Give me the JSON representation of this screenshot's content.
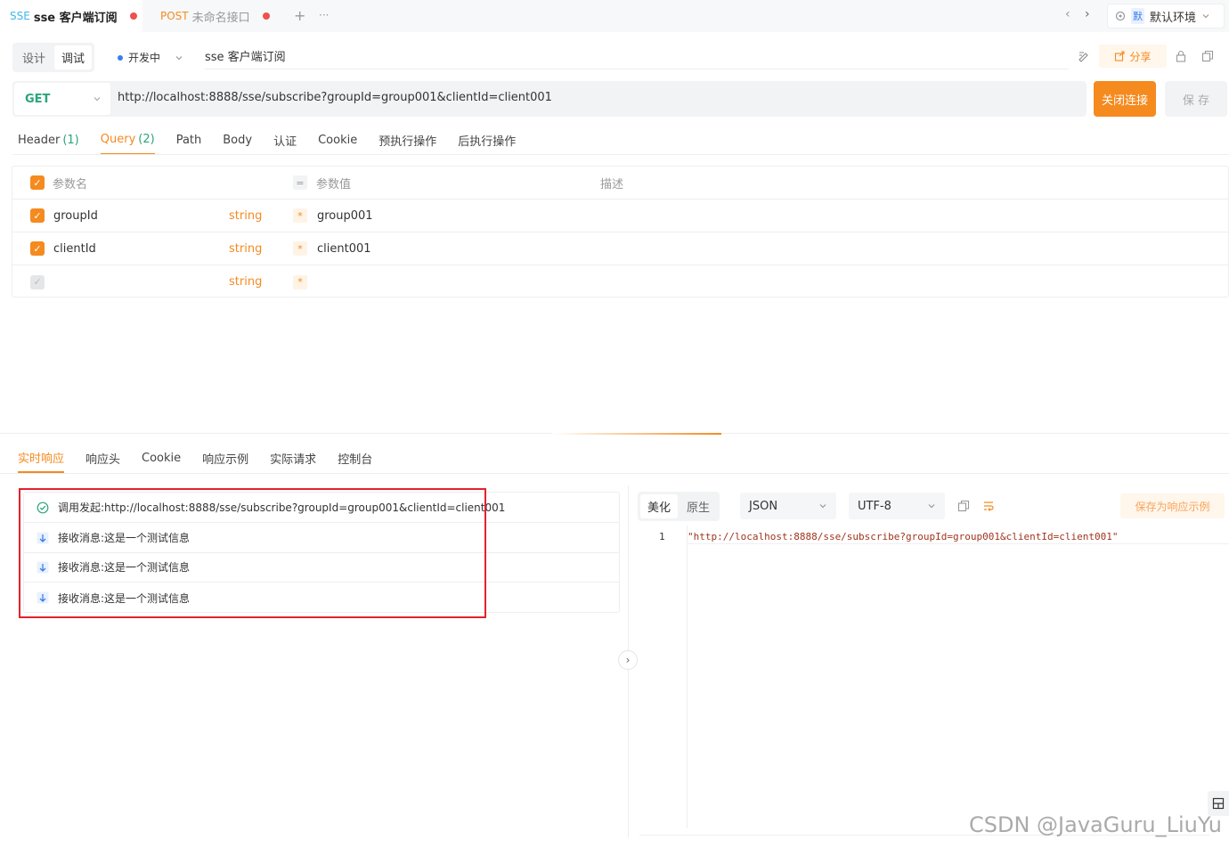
{
  "tabs": [
    {
      "prefix": "SSE",
      "label": "sse 客户端订阅",
      "active": true
    },
    {
      "prefix": "POST",
      "label": "未命名接口",
      "active": false
    }
  ],
  "tabbar": {
    "add": "+",
    "more": "···",
    "nav_left": "‹",
    "nav_right": "›"
  },
  "env": {
    "badge": "默",
    "label": "默认环境"
  },
  "toolbar": {
    "mode_design": "设计",
    "mode_debug": "调试",
    "status": "开发中",
    "api_name": "sse 客户端订阅",
    "share": "分享"
  },
  "request": {
    "method": "GET",
    "url": "http://localhost:8888/sse/subscribe?groupId=group001&clientId=client001",
    "close_button": "关闭连接",
    "save_button": "保 存"
  },
  "request_tabs": [
    {
      "label": "Header",
      "count": "(1)"
    },
    {
      "label": "Query",
      "count": "(2)"
    },
    {
      "label": "Path",
      "count": ""
    },
    {
      "label": "Body",
      "count": ""
    },
    {
      "label": "认证",
      "count": ""
    },
    {
      "label": "Cookie",
      "count": ""
    },
    {
      "label": "预执行操作",
      "count": ""
    },
    {
      "label": "后执行操作",
      "count": ""
    }
  ],
  "params": {
    "headers": {
      "name": "参数名",
      "eq": "=",
      "value": "参数值",
      "desc": "描述"
    },
    "rows": [
      {
        "name": "groupId",
        "type": "string",
        "value": "group001",
        "checked": true
      },
      {
        "name": "clientId",
        "type": "string",
        "value": "client001",
        "checked": true
      },
      {
        "name": "",
        "type": "string",
        "value": "",
        "checked": false
      }
    ]
  },
  "response_tabs": [
    "实时响应",
    "响应头",
    "Cookie",
    "响应示例",
    "实际请求",
    "控制台"
  ],
  "events": [
    {
      "text": "调用发起:http://localhost:8888/sse/subscribe?groupId=group001&clientId=client001",
      "kind": "ok"
    },
    {
      "text": "接收消息:这是一个测试信息",
      "kind": "recv"
    },
    {
      "text": "接收消息:这是一个测试信息",
      "kind": "recv"
    },
    {
      "text": "接收消息:这是一个测试信息",
      "kind": "recv"
    }
  ],
  "viewer": {
    "pretty": "美化",
    "raw": "原生",
    "format": "JSON",
    "encoding": "UTF-8",
    "save_example": "保存为响应示例",
    "line_no": "1",
    "line": "\"http://localhost:8888/sse/subscribe?groupId=group001&clientId=client001\""
  },
  "watermark": "CSDN @JavaGuru_LiuYu",
  "colors": {
    "accent": "#f58a1f",
    "get": "#2aa57a",
    "highlight_box": "#e3222c"
  }
}
